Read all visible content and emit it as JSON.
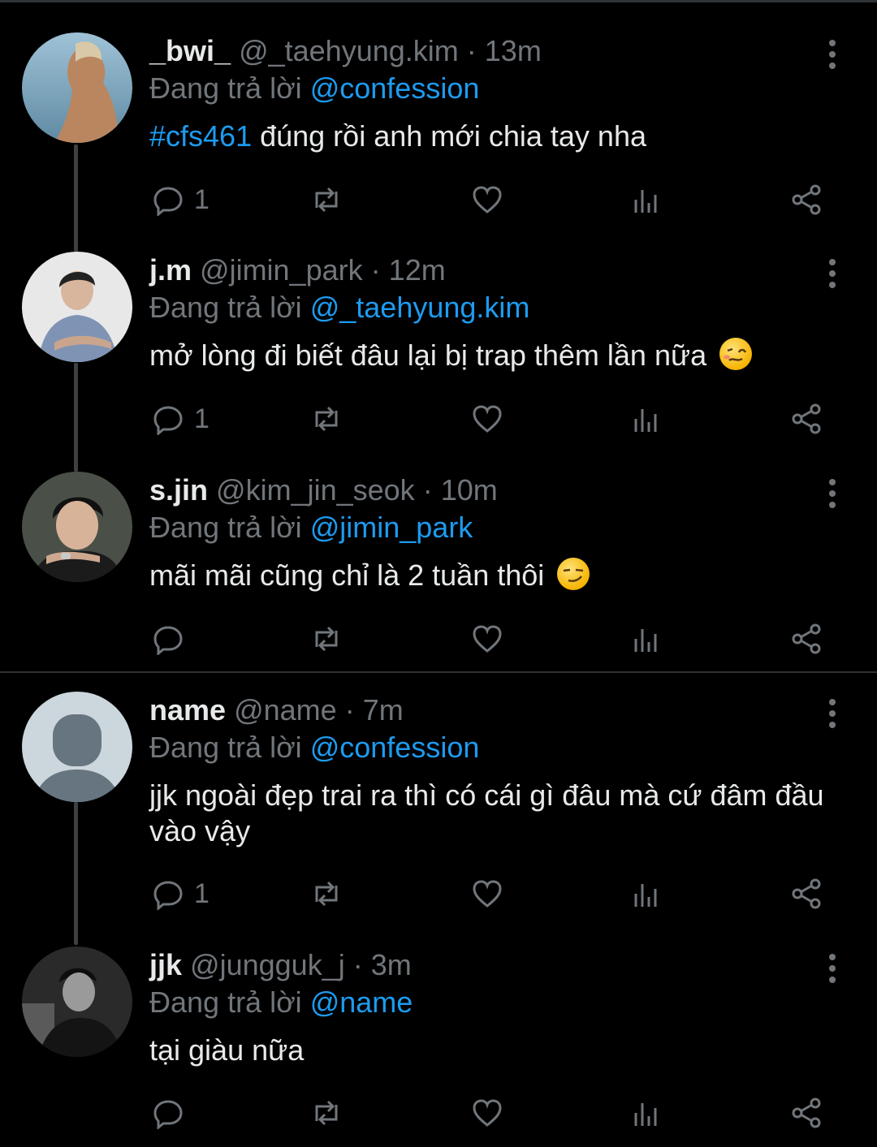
{
  "reply_prefix": "Đang trả lời",
  "tweets": [
    {
      "name": "_bwi_",
      "handle": "@_taehyung.kim",
      "time": "13m",
      "reply_to": "@confession",
      "hashtag": "#cfs461",
      "text": " đúng rồi anh mới chia tay nha",
      "reply_count": "1",
      "emoji": ""
    },
    {
      "name": "j.m",
      "handle": "@jimin_park",
      "time": "12m",
      "reply_to": "@_taehyung.kim",
      "hashtag": "",
      "text": "mở lòng đi biết đâu lại bị trap thêm lần nữa",
      "reply_count": "1",
      "emoji": "woozy-face"
    },
    {
      "name": "s.jin",
      "handle": "@kim_jin_seok",
      "time": "10m",
      "reply_to": "@jimin_park",
      "hashtag": "",
      "text": "mãi mãi cũng chỉ là 2 tuần thôi",
      "reply_count": "",
      "emoji": "smirking-face"
    },
    {
      "name": "name",
      "handle": "@name",
      "time": "7m",
      "reply_to": "@confession",
      "hashtag": "",
      "text": "jjk ngoài đẹp trai ra thì có cái gì đâu mà cứ đâm đầu vào vậy",
      "reply_count": "1",
      "emoji": ""
    },
    {
      "name": "jjk",
      "handle": "@jungguk_j",
      "time": "3m",
      "reply_to": "@name",
      "hashtag": "",
      "text": "tại giàu nữa",
      "reply_count": "",
      "emoji": ""
    }
  ],
  "colors": {
    "background": "#000000",
    "link": "#1d9bf0",
    "muted": "#71767b",
    "text": "#e7e9ea"
  }
}
